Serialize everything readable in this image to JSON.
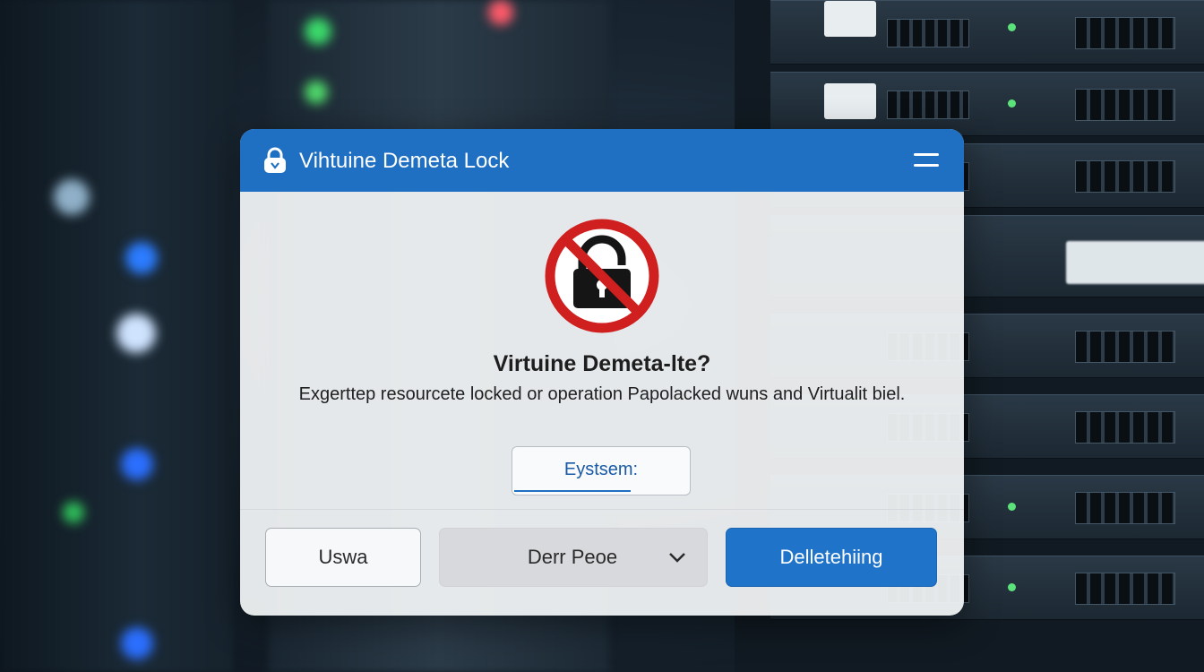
{
  "dialog": {
    "title": "Vihtuine Demeta Lock",
    "heading": "Virtuine Demeta-lte?",
    "message": "Exgerttep resourcete locked or operation Papolacked wuns and Virtualit biel.",
    "system_field": {
      "value": "Eystsem:"
    },
    "buttons": {
      "cancel": "Uswa",
      "select": "Derr Peoe",
      "primary": "Delletehiing"
    }
  },
  "icons": {
    "title": "lock-icon",
    "menu": "hamburger-menu-icon",
    "status": "forbidden-lock-icon",
    "dropdown": "chevron-down-icon"
  },
  "colors": {
    "accent": "#1f6fc2",
    "forbidden": "#d01f1f",
    "primary_button": "#1f73c9"
  }
}
